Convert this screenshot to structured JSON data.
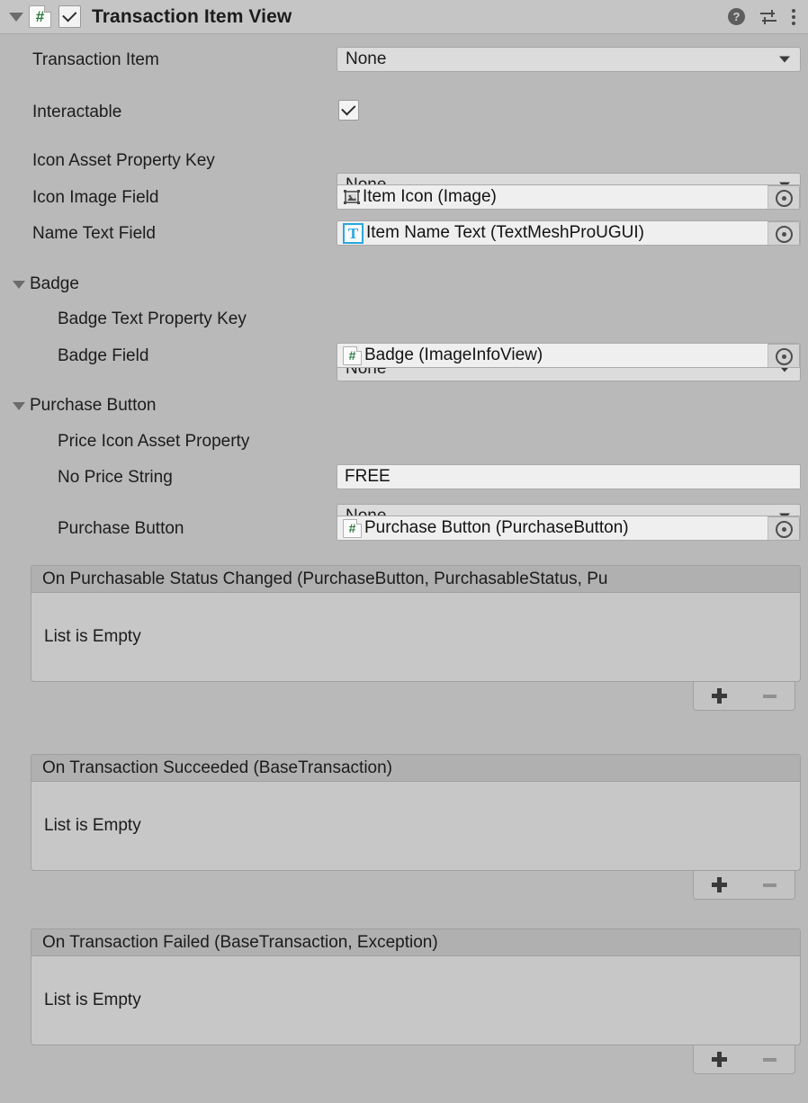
{
  "header": {
    "title": "Transaction Item View",
    "script_icon": "#",
    "enabled": true,
    "foldout_open": true,
    "icons": {
      "help": "help-icon",
      "preset": "preset-settings-icon",
      "menu": "kebab-menu-icon"
    }
  },
  "fields": [
    {
      "label": "Transaction Item",
      "type": "popup",
      "value": "None",
      "indent": 0
    },
    {
      "label": "Interactable",
      "type": "checkbox",
      "value": true,
      "indent": 0
    },
    {
      "label": "Icon Asset Property Key",
      "type": "popup",
      "value": "None",
      "indent": 0
    },
    {
      "label": "Icon Image Field",
      "type": "object",
      "value": "Item Icon (Image)",
      "icon": "image-type-icon",
      "indent": 0
    },
    {
      "label": "Name Text Field",
      "type": "object",
      "value": "Item Name Text (TextMeshProUGUI)",
      "icon": "textmeshpro-type-icon",
      "indent": 0
    }
  ],
  "sections": [
    {
      "title": "Badge",
      "fields": [
        {
          "label": "Badge Text Property Key",
          "type": "popup",
          "value": "None"
        },
        {
          "label": "Badge Field",
          "type": "object",
          "value": "Badge (ImageInfoView)",
          "icon": "script-type-icon",
          "icon_glyph": "#"
        }
      ]
    },
    {
      "title": "Purchase Button",
      "fields": [
        {
          "label": "Price Icon Asset Property",
          "type": "popup",
          "value": "None"
        },
        {
          "label": "No Price String",
          "type": "text",
          "value": "FREE"
        },
        {
          "label": "Purchase Button",
          "type": "object",
          "value": "Purchase Button (PurchaseButton)",
          "icon": "script-type-icon",
          "icon_glyph": "#"
        }
      ]
    }
  ],
  "events": [
    {
      "title": "On Purchasable Status Changed (PurchaseButton, PurchasableStatus, Pu",
      "empty_text": "List is Empty",
      "add_label": "+",
      "remove_label": "-",
      "remove_enabled": false
    },
    {
      "title": "On Transaction Succeeded (BaseTransaction)",
      "empty_text": "List is Empty",
      "add_label": "+",
      "remove_label": "-",
      "remove_enabled": false
    },
    {
      "title": "On Transaction Failed (BaseTransaction, Exception)",
      "empty_text": "List is Empty",
      "add_label": "+",
      "remove_label": "-",
      "remove_enabled": false
    }
  ],
  "colors": {
    "background": "#b9b9b9",
    "header_bar": "#c5c5c5",
    "popup_bg": "#dcdcdc",
    "field_bg": "#efefef",
    "event_header": "#b0b0b0",
    "event_body": "#c7c7c7",
    "script_green": "#2d7a40",
    "tmp_blue": "#28a8e0"
  }
}
